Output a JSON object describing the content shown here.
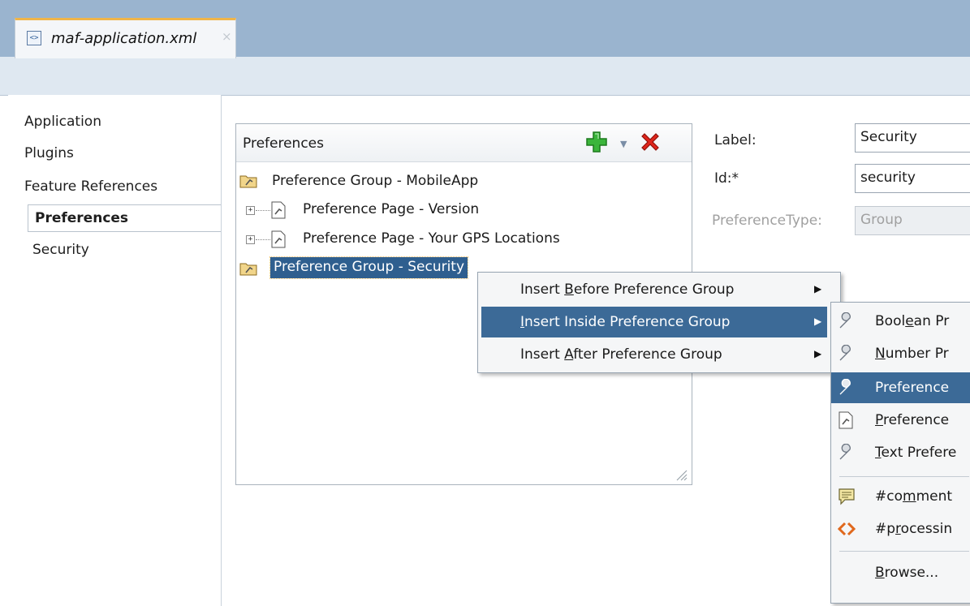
{
  "tab": {
    "title": "maf-application.xml",
    "close": "×",
    "icon": "xml-file-icon"
  },
  "nav": {
    "items": [
      "Application",
      "Plugins",
      "Feature References",
      "Preferences",
      "Security"
    ],
    "active": "Preferences"
  },
  "preferences": {
    "title": "Preferences",
    "tree": [
      {
        "label": "Preference Group - MobileApp",
        "icon": "preference-group-icon"
      },
      {
        "label": "Preference Page - Version",
        "icon": "preference-page-icon",
        "expander": "+"
      },
      {
        "label": "Preference Page - Your GPS Locations",
        "icon": "preference-page-icon",
        "expander": "+"
      },
      {
        "label": "Preference Group - Security",
        "icon": "preference-group-icon",
        "selected": true
      }
    ]
  },
  "form": {
    "label_label": "Label:",
    "label_value": "Security",
    "id_label": "Id:*",
    "id_value": "security",
    "type_label": "PreferenceType:",
    "type_value": "Group"
  },
  "context_menu": {
    "items": [
      {
        "prefix": "Insert ",
        "mnemonic": "B",
        "suffix": "efore Preference Group"
      },
      {
        "prefix": "",
        "mnemonic": "I",
        "suffix": "nsert Inside Preference Group"
      },
      {
        "prefix": "Insert ",
        "mnemonic": "A",
        "suffix": "fter Preference Group"
      }
    ],
    "highlighted": 1
  },
  "submenu": {
    "items": [
      {
        "prefix": "Bool",
        "mnemonic": "e",
        "suffix": "an Pr",
        "icon": "wrench-icon"
      },
      {
        "prefix": "",
        "mnemonic": "N",
        "suffix": "umber Pr",
        "icon": "wrench-icon"
      },
      {
        "prefix": "",
        "mnemonic": "",
        "suffix": "Preference",
        "icon": "wrench-icon"
      },
      {
        "prefix": "",
        "mnemonic": "P",
        "suffix": "reference",
        "icon": "preference-page-icon"
      },
      {
        "prefix": "",
        "mnemonic": "T",
        "suffix": "ext Prefere",
        "icon": "wrench-icon"
      },
      {
        "prefix": "#co",
        "mnemonic": "m",
        "suffix": "ment",
        "icon": "comment-icon"
      },
      {
        "prefix": "#p",
        "mnemonic": "r",
        "suffix": "ocessin",
        "icon": "processing-instruction-icon"
      },
      {
        "prefix": "",
        "mnemonic": "B",
        "suffix": "rowse...",
        "icon": ""
      }
    ],
    "highlighted": 2
  },
  "colors": {
    "selection": "#2f5f8f",
    "menu_highlight": "#3c6a97",
    "tab_accent": "#f0b54a"
  }
}
